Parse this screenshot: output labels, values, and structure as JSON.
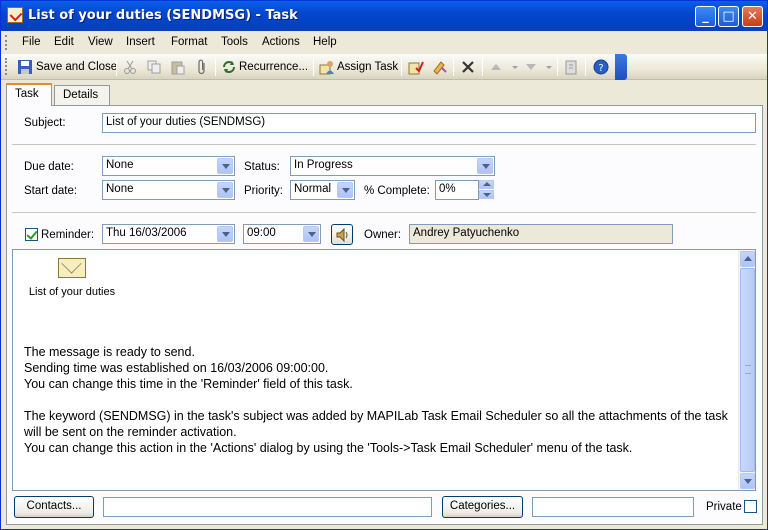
{
  "window": {
    "title": "List of your duties (SENDMSG) - Task",
    "min_label": "_",
    "max_label": "□",
    "close_label": "✕"
  },
  "menu": [
    "File",
    "Edit",
    "View",
    "Insert",
    "Format",
    "Tools",
    "Actions",
    "Help"
  ],
  "toolbar": {
    "save_close": "Save and Close",
    "recurrence": "Recurrence...",
    "assign_task": "Assign Task"
  },
  "tabs": {
    "task": "Task",
    "details": "Details"
  },
  "form": {
    "subject_label": "Subject:",
    "subject_value": "List of your duties (SENDMSG)",
    "due_label": "Due date:",
    "due_value": "None",
    "start_label": "Start date:",
    "start_value": "None",
    "status_label": "Status:",
    "status_value": "In Progress",
    "priority_label": "Priority:",
    "priority_value": "Normal",
    "complete_label": "% Complete:",
    "complete_value": "0%",
    "reminder_label": "Reminder:",
    "reminder_checked": true,
    "reminder_date": "Thu 16/03/2006",
    "reminder_time": "09:00",
    "owner_label": "Owner:",
    "owner_value": "Andrey Patyuchenko"
  },
  "body": {
    "attachment_name": "List of your duties",
    "lines": [
      "The message is ready to send.",
      "Sending time was established on 16/03/2006 09:00:00.",
      "You can change this time in the 'Reminder' field of this task.",
      "",
      "The keyword (SENDMSG) in the task's subject was added by MAPILab Task Email Scheduler so all the attachments of the task will be sent on the reminder activation.",
      "You can change this action in the 'Actions' dialog by using the 'Tools->Task Email Scheduler' menu of the task."
    ]
  },
  "footer": {
    "contacts_button": "Contacts...",
    "contacts_value": "",
    "categories_button": "Categories...",
    "categories_value": "",
    "private_label": "Private",
    "private_checked": false
  },
  "colors": {
    "titlebar": "#0a5fe8",
    "window_bg": "#ece9d8",
    "tab_accent": "#e68b2c"
  }
}
